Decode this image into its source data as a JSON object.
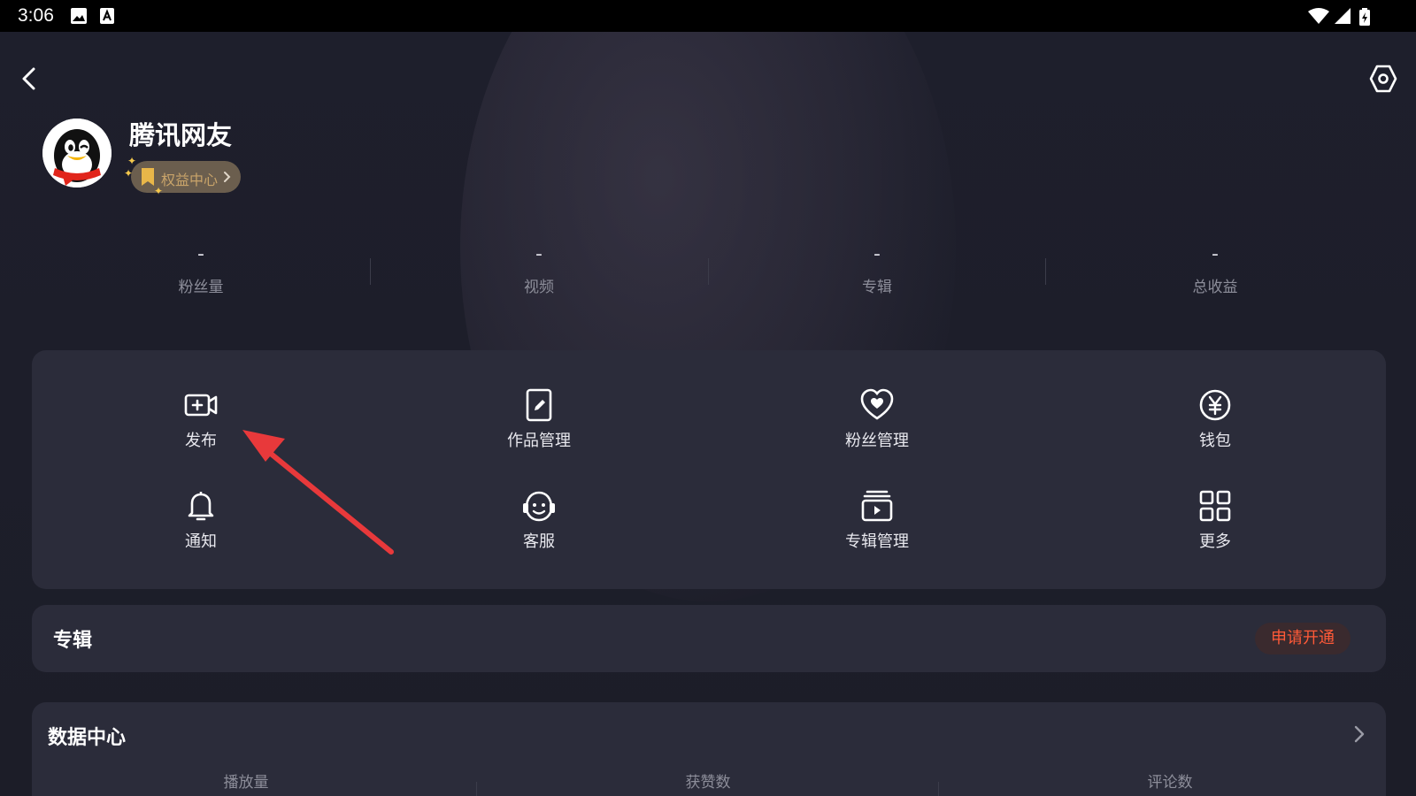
{
  "status_bar": {
    "time": "3:06",
    "left_icons": [
      "image-icon",
      "app-a-icon"
    ],
    "right_icons": [
      "wifi-icon",
      "signal-icon",
      "battery-charging-icon"
    ]
  },
  "header": {
    "back_icon": "chevron-left-icon",
    "settings_icon": "settings-hex-icon"
  },
  "profile": {
    "username": "腾讯网友",
    "rights_label": "权益中心"
  },
  "stats": [
    {
      "value": "-",
      "label": "粉丝量"
    },
    {
      "value": "-",
      "label": "视频"
    },
    {
      "value": "-",
      "label": "专辑"
    },
    {
      "value": "-",
      "label": "总收益"
    }
  ],
  "grid": [
    {
      "label": "发布",
      "icon": "video-add-icon"
    },
    {
      "label": "作品管理",
      "icon": "edit-doc-icon"
    },
    {
      "label": "粉丝管理",
      "icon": "heart-icon"
    },
    {
      "label": "钱包",
      "icon": "yen-coin-icon"
    },
    {
      "label": "通知",
      "icon": "bell-icon"
    },
    {
      "label": "客服",
      "icon": "headset-icon"
    },
    {
      "label": "专辑管理",
      "icon": "album-play-icon"
    },
    {
      "label": "更多",
      "icon": "grid-icon"
    }
  ],
  "album": {
    "title": "专辑",
    "apply_label": "申请开通"
  },
  "data_center": {
    "title": "数据中心",
    "columns": [
      "播放量",
      "获赞数",
      "评论数"
    ]
  },
  "colors": {
    "background": "#1c1d28",
    "card": "#2b2c3a",
    "accent_orange": "#ff5a38",
    "badge_gold": "#c9a46a",
    "annotation_red": "#e8393b"
  }
}
